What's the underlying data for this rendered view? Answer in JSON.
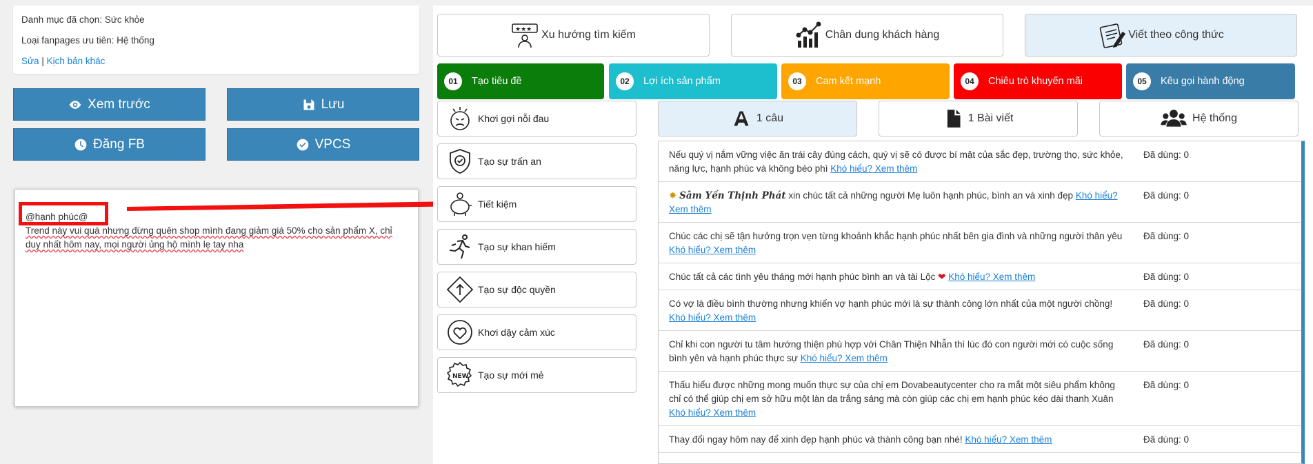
{
  "info": {
    "category": "Danh mục đã chọn: Sức khỏe",
    "fanpage_type": "Loại fanpages ưu tiên: Hệ thống",
    "edit_link": "Sửa",
    "separator": "|",
    "other_script_link": "Kịch bản khác"
  },
  "actions": {
    "preview": "Xem trước",
    "save": "Lưu",
    "post_fb": "Đăng FB",
    "vpcs": "VPCS"
  },
  "editor": {
    "tag": "@hạnh phúc@",
    "text": "Trend này vui quá nhưng đừng quên shop mình đang giảm giá 50% cho sản phẩm X, chỉ duy nhất hôm nay, mọi người ủng hộ mình lẹ tay nha"
  },
  "top_tabs": [
    {
      "label": "Xu hướng tìm kiếm",
      "icon": "rating-person-icon"
    },
    {
      "label": "Chân dung khách hàng",
      "icon": "growth-chart-icon"
    },
    {
      "label": "Viết theo công thức",
      "icon": "notepad-pencil-icon",
      "active": true
    }
  ],
  "steps": [
    {
      "num": "01",
      "label": "Tạo tiêu đề",
      "color": "#0b7d0b"
    },
    {
      "num": "02",
      "label": "Lợi ích sản phẩm",
      "color": "#1dbfcf"
    },
    {
      "num": "03",
      "label": "Cam kết mạnh",
      "color": "#ffa500"
    },
    {
      "num": "04",
      "label": "Chiêu trò khuyến mãi",
      "color": "#fb0000"
    },
    {
      "num": "05",
      "label": "Kêu gọi hành động",
      "color": "#3a7ca8"
    }
  ],
  "side_items": [
    {
      "label": "Khơi gợi nỗi đau",
      "icon": "stressed-face-icon"
    },
    {
      "label": "Tạo sự trấn an",
      "icon": "shield-check-icon"
    },
    {
      "label": "Tiết kiệm",
      "icon": "piggy-bank-icon"
    },
    {
      "label": "Tạo sự khan hiếm",
      "icon": "running-man-icon"
    },
    {
      "label": "Tạo sự độc quyền",
      "icon": "direction-sign-icon"
    },
    {
      "label": "Khơi dậy cảm xúc",
      "icon": "heart-icon"
    },
    {
      "label": "Tạo sự mới mẻ",
      "icon": "new-badge-icon"
    }
  ],
  "length_tabs": [
    {
      "label": "1 câu",
      "icon": "font-a-icon",
      "active": true
    },
    {
      "label": "1 Bài viết",
      "icon": "file-icon"
    },
    {
      "label": "Hệ thống",
      "icon": "users-icon"
    }
  ],
  "link_text": "Khó hiểu? Xem thêm",
  "rows": [
    {
      "text": "Nếu quý vị nắm vững việc ăn trái cây đúng cách, quý vị sẽ có được bí mật của sắc đẹp, trường thọ, sức khỏe, năng lực, hạnh phúc và không béo phì",
      "used": "Đã dùng: 0"
    },
    {
      "prefix": "Sâm Yến Thịnh Phát",
      "text": "xin chúc tất cả những người Mẹ luôn hạnh phúc, bình an và xinh đẹp",
      "used": "Đã dùng: 0"
    },
    {
      "text": "Chúc các chị sẽ tận hưởng trọn vẹn từng khoảnh khắc hạnh phúc nhất bên gia đình và những người thân yêu",
      "used": "Đã dùng: 0"
    },
    {
      "text": "Chúc tất cả các tình yêu tháng mới hạnh phúc bình an và tài Lộc",
      "suffix": "❤",
      "used": "Đã dùng: 0"
    },
    {
      "text": "Có vợ là điều bình thường nhưng khiến vợ hạnh phúc mới là sự thành công lớn nhất của một người chồng!",
      "used": "Đã dùng: 0"
    },
    {
      "text": "Chỉ khi con người tu tâm hướng thiện phù hợp với Chân Thiện Nhẫn thì lúc đó con người mới có cuộc sống bình yên và hạnh phúc thực sự",
      "used": "Đã dùng: 0"
    },
    {
      "text": "Thấu hiểu được những mong muốn thực sự của chị em Dovabeautycenter cho ra mắt một siêu phẩm không chỉ có thể giúp chị em sở hữu một làn da trắng sáng mà còn giúp các chị em hạnh phúc kéo dài thanh Xuân",
      "used": "Đã dùng: 0"
    },
    {
      "text": "Thay đổi ngay hôm nay để xinh đẹp hạnh phúc và thành công bạn nhé!",
      "used": "Đã dùng: 0"
    }
  ]
}
